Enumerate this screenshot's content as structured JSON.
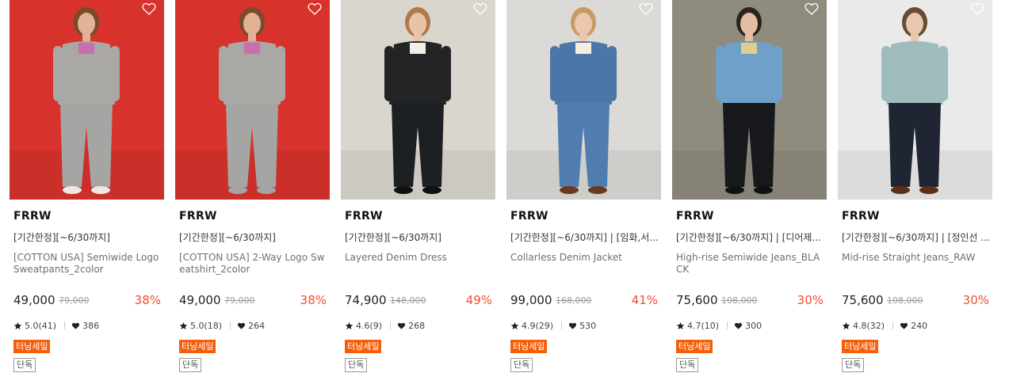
{
  "products": [
    {
      "brand": "FRRW",
      "promo": "[기간한정][~6/30까지]",
      "name": "[COTTON USA] Semiwide Logo Sweatpants_2color",
      "price": "49,000",
      "original_price": "79,000",
      "discount": "38%",
      "rating": "5.0(41)",
      "likes": "386",
      "sale_tag": "터닝세일",
      "exclusive_tag": "단독",
      "photo": {
        "bg": "#d8322c",
        "top": "#a9a8a5",
        "bottom": "#a5a5a3",
        "skin": "#e2b196",
        "hair": "#7a4a2c",
        "accent": "#c96fb0",
        "shoe": "#f0e8e5"
      }
    },
    {
      "brand": "FRRW",
      "promo": "[기간한정][~6/30까지]",
      "name": "[COTTON USA] 2-Way Logo Sweatshirt_2color",
      "price": "49,000",
      "original_price": "79,000",
      "discount": "38%",
      "rating": "5.0(18)",
      "likes": "264",
      "sale_tag": "터닝세일",
      "exclusive_tag": "단독",
      "photo": {
        "bg": "#d8322c",
        "top": "#a9a8a5",
        "bottom": "#a5a5a3",
        "skin": "#e2b196",
        "hair": "#7a4a2c",
        "accent": "#c96fb0",
        "shoe": "#a5a5a3"
      }
    },
    {
      "brand": "FRRW",
      "promo": "[기간한정][~6/30까지]",
      "name": "Layered Denim Dress",
      "price": "74,900",
      "original_price": "148,000",
      "discount": "49%",
      "rating": "4.6(9)",
      "likes": "268",
      "sale_tag": "터닝세일",
      "exclusive_tag": "단독",
      "photo": {
        "bg": "#d9d6ce",
        "top": "#222426",
        "bottom": "#1c1f24",
        "skin": "#e8c3aa",
        "hair": "#b07a4a",
        "accent": "#f2efe8",
        "shoe": "#111111"
      }
    },
    {
      "brand": "FRRW",
      "promo": "[기간한정][~6/30까지] | [임화,서...",
      "name": "Collarless Denim Jacket",
      "price": "99,000",
      "original_price": "168,000",
      "discount": "41%",
      "rating": "4.9(29)",
      "likes": "530",
      "sale_tag": "터닝세일",
      "exclusive_tag": "단독",
      "photo": {
        "bg": "#dcdad6",
        "top": "#4b77a8",
        "bottom": "#4f7db0",
        "skin": "#ecc7b0",
        "hair": "#c99a62",
        "accent": "#f4ede2",
        "shoe": "#6b3a1e"
      }
    },
    {
      "brand": "FRRW",
      "promo": "[기간한정][~6/30까지] | [디어제...",
      "name": "High-rise Semiwide Jeans_BLACK",
      "price": "75,600",
      "original_price": "108,000",
      "discount": "30%",
      "rating": "4.7(10)",
      "likes": "300",
      "sale_tag": "터닝세일",
      "exclusive_tag": "단독",
      "photo": {
        "bg": "#8f8c7e",
        "top": "#6fa0c8",
        "bottom": "#17181c",
        "skin": "#e4bda2",
        "hair": "#2a2420",
        "accent": "#e0ce8e",
        "shoe": "#111111"
      }
    },
    {
      "brand": "FRRW",
      "promo": "[기간한정][~6/30까지] | [정인선 ...",
      "name": "Mid-rise Straight Jeans_RAW",
      "price": "75,600",
      "original_price": "108,000",
      "discount": "30%",
      "rating": "4.8(32)",
      "likes": "240",
      "sale_tag": "터닝세일",
      "exclusive_tag": "단독",
      "photo": {
        "bg": "#eaeaea",
        "top": "#9fbcbd",
        "bottom": "#1f2533",
        "skin": "#e8c7b2",
        "hair": "#6a4a32",
        "accent": "#9fbcbd",
        "shoe": "#5a3018"
      }
    }
  ]
}
